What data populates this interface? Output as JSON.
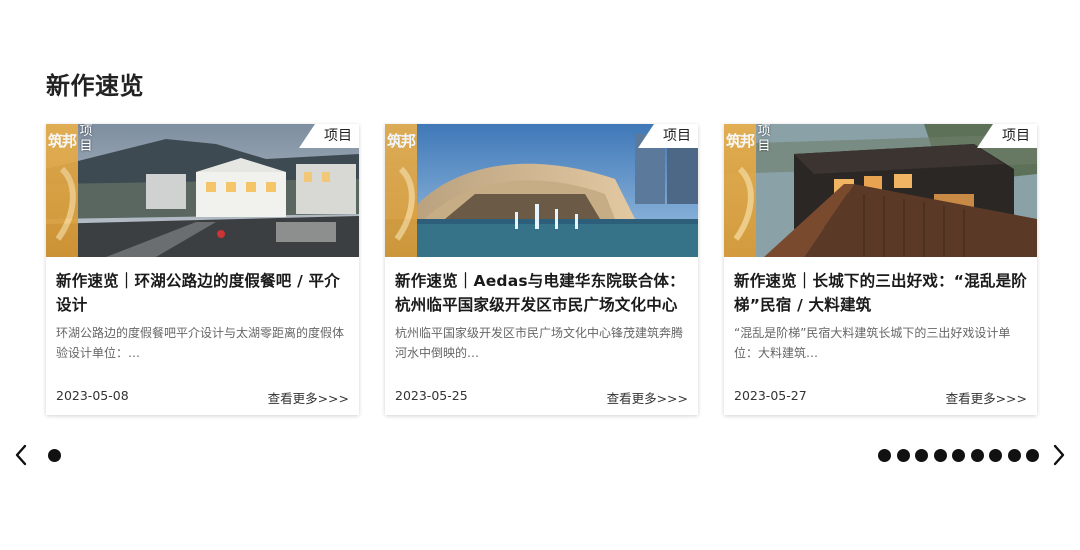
{
  "section": {
    "title": "新作速览"
  },
  "cards": [
    {
      "category_label": "项目",
      "category_vertical": "项\n目",
      "logo_text": "筑邦",
      "title": "新作速览｜环湖公路边的度假餐吧 / 平介设计",
      "description": "环湖公路边的度假餐吧平介设计与太湖零距离的度假体验设计单位：…",
      "date": "2023-05-08",
      "more_label": "查看更多>>>"
    },
    {
      "category_label": "项目",
      "category_vertical": "",
      "logo_text": "筑邦",
      "title": "新作速览｜Aedas与电建华东院联合体：杭州临平国家级开发区市民广场文化中心",
      "description": "杭州临平国家级开发区市民广场文化中心锋茂建筑奔腾河水中倒映的…",
      "date": "2023-05-25",
      "more_label": "查看更多>>>"
    },
    {
      "category_label": "项目",
      "category_vertical": "项\n目",
      "logo_text": "筑邦",
      "title": "新作速览｜长城下的三出好戏：“混乱是阶梯”民宿 / 大料建筑",
      "description": "“混乱是阶梯”民宿大料建筑长城下的三出好戏设计单位：大料建筑…",
      "date": "2023-05-27",
      "more_label": "查看更多>>>"
    }
  ],
  "pagination": {
    "dot_count": 10,
    "active_index": 0,
    "left_icon": "chevron-left-icon",
    "right_icon": "chevron-right-icon"
  },
  "colors": {
    "logo_strip": "#e2a542",
    "dot": "#111111"
  }
}
